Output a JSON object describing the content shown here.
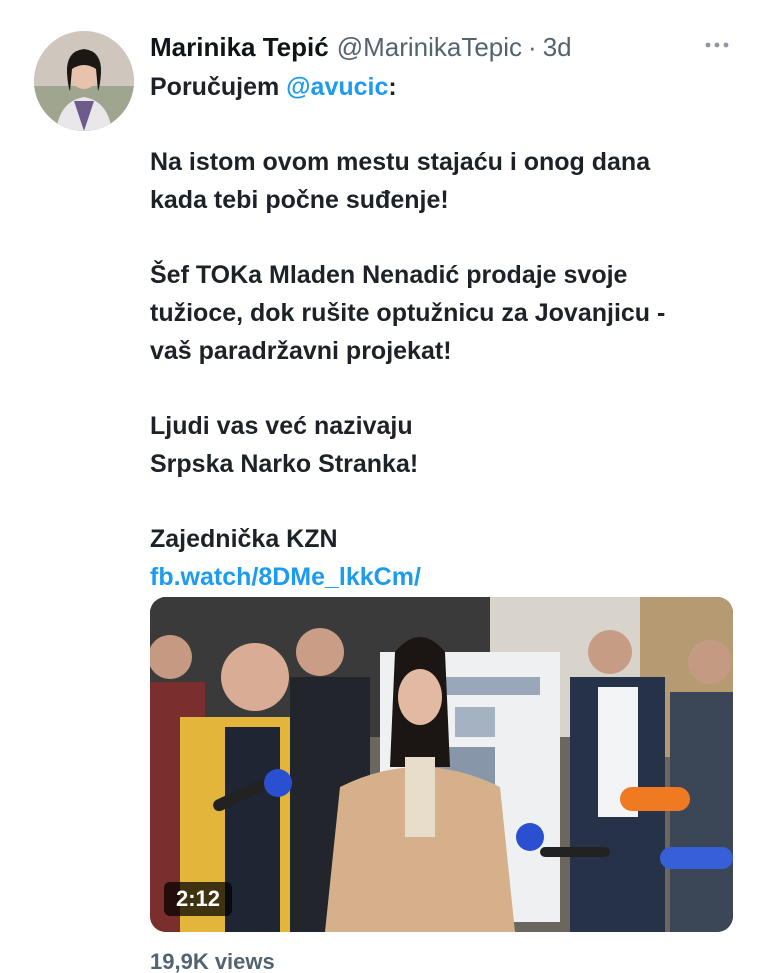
{
  "tweet": {
    "author": {
      "display_name": "Marinika Tepić",
      "handle": "@MarinikaTepic",
      "separator": "·",
      "timestamp": "3d",
      "avatar_icon": "profile-photo"
    },
    "more_icon": "ellipsis-icon",
    "text": {
      "line1_prefix": "Poručujem ",
      "line1_mention": "@avucic",
      "line1_suffix": ":",
      "para1_line1": "Na istom ovom mestu stajaću i onog dana",
      "para1_line2": "kada tebi počne suđenje!",
      "para2_line1": "Šef TOKa Mladen Nenadić prodaje svoje",
      "para2_line2": "tužioce, dok rušite optužnicu za Jovanjicu -",
      "para2_line3": "vaš paradržavni projekat!",
      "para3_line1": "Ljudi vas već nazivaju",
      "para3_line2": "Srpska Narko Stranka!",
      "signature": "Zajednička KZN",
      "link": "fb.watch/8DMe_lkkCm/"
    },
    "media": {
      "duration": "2:12",
      "type": "video"
    },
    "views": "19,9K views",
    "colors": {
      "link": "#1d9bf0",
      "text": "#0f1419",
      "muted": "#536471"
    }
  }
}
